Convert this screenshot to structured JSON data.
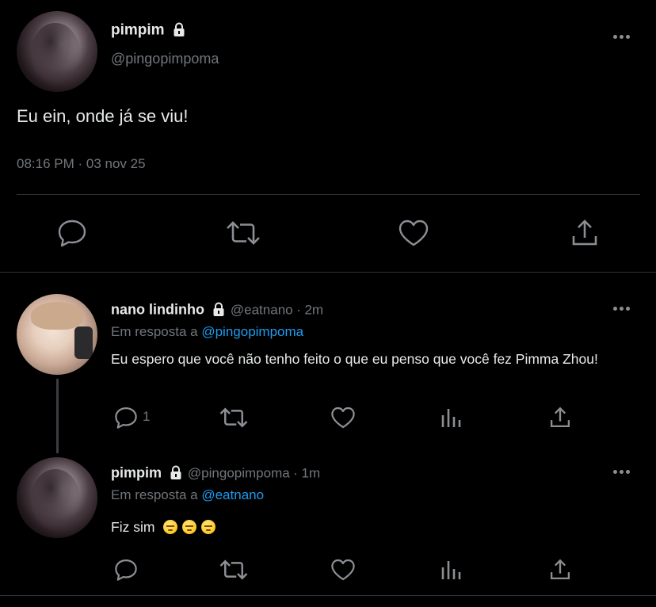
{
  "main_tweet": {
    "display_name": "pimpim",
    "handle": "@pingopimpoma",
    "text": "Eu ein, onde já se viu!",
    "timestamp": "08:16 PM · 03 nov 25",
    "avatar_icon": "avatar-pimpim",
    "actions": [
      "reply-icon",
      "retweet-icon",
      "like-icon",
      "share-icon"
    ]
  },
  "replies": [
    {
      "display_name": "nano lindinho",
      "handle": "@eatnano",
      "time": "· 2m",
      "reply_prefix": "Em resposta a",
      "reply_to": "@pingopimpoma",
      "text": "Eu espero que você não tenho feito o que eu penso que você fez Pimma Zhou!",
      "reply_count": "1"
    },
    {
      "display_name": "pimpim",
      "handle": "@pingopimpoma",
      "time": "· 1m",
      "reply_prefix": "Em resposta a",
      "reply_to": "@eatnano",
      "text": "Fiz sim",
      "emoji_names": [
        "unamused-face-emoji",
        "unamused-face-emoji",
        "unamused-face-emoji"
      ]
    }
  ],
  "colors": {
    "background": "#000000",
    "text": "#e7e9ea",
    "muted": "#71767b",
    "link": "#1d9bf0",
    "divider": "#2f3336"
  }
}
